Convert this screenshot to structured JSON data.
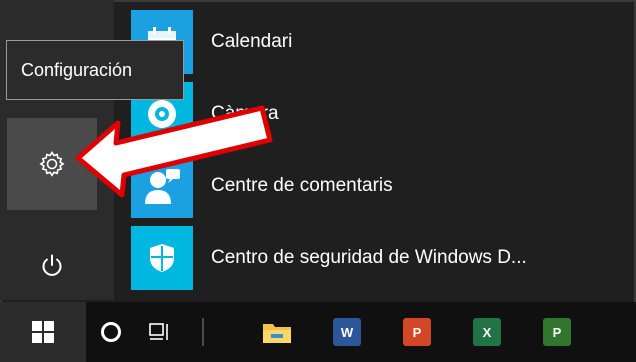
{
  "tooltip": {
    "text": "Configuración"
  },
  "rail": {
    "settings_icon": "gear-icon",
    "power_icon": "power-icon"
  },
  "apps": [
    {
      "label": "Calendari",
      "icon": "calendar-icon"
    },
    {
      "label": "Càmera",
      "icon": "camera-icon"
    },
    {
      "label": "Centre de comentaris",
      "icon": "feedback-person-icon"
    },
    {
      "label": "Centro de seguridad de Windows D...",
      "icon": "shield-icon"
    }
  ],
  "taskbar": {
    "items": [
      {
        "name": "start",
        "icon": "windows-logo-icon"
      },
      {
        "name": "cortana",
        "icon": "cortana-circle-icon"
      },
      {
        "name": "task-view",
        "icon": "task-view-icon"
      },
      {
        "name": "file-explorer",
        "icon": "folder-icon"
      },
      {
        "name": "word",
        "badge": "W",
        "color": "#2b579a"
      },
      {
        "name": "powerpoint",
        "badge": "P",
        "color": "#d24726"
      },
      {
        "name": "excel",
        "badge": "X",
        "color": "#217346"
      },
      {
        "name": "project",
        "badge": "P",
        "color": "#31752f"
      }
    ]
  },
  "colors": {
    "tile_blue": "#1ba1e2",
    "annotation_arrow": "#e00000"
  }
}
